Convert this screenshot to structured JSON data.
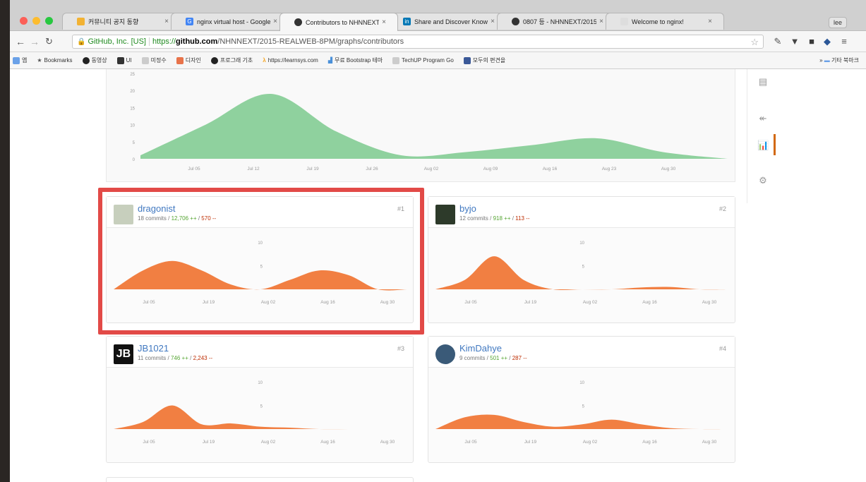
{
  "browser": {
    "tabs": [
      {
        "title": "커뮤니티 공지 동향",
        "color": "#f2b233",
        "active": false
      },
      {
        "title": "nginx virtual host - Google",
        "color": "#4285f4",
        "active": false
      },
      {
        "title": "Contributors to NHNNEXT",
        "color": "#333333",
        "active": true
      },
      {
        "title": "Share and Discover Knowl",
        "color": "#0077b5",
        "active": false
      },
      {
        "title": "0807 등 - NHNNEXT/2015",
        "color": "#333333",
        "active": false
      },
      {
        "title": "Welcome to nginx!",
        "color": "#dddddd",
        "active": false
      }
    ],
    "new_tab_label": "lee",
    "site_identity": "GitHub, Inc. [US]",
    "url_scheme": "https://",
    "url_host": "github.com",
    "url_path": "/NHNNEXT/2015-REALWEB-8PM/graphs/contributors",
    "bookmarks": [
      {
        "label": "앱",
        "color": "#6aa1e8"
      },
      {
        "label": "Bookmarks",
        "color": "#777777"
      },
      {
        "label": "동영상",
        "color": "#222222"
      },
      {
        "label": "UI",
        "color": "#333333"
      },
      {
        "label": "미정수",
        "color": "#cccccc"
      },
      {
        "label": "디자인",
        "color": "#e8734a"
      },
      {
        "label": "프로그래 기초",
        "color": "#222222"
      },
      {
        "label": "https://learnsys.com",
        "color": "#f6a623"
      },
      {
        "label": "무료 Bootstrap 테마",
        "color": "#4a90d9"
      },
      {
        "label": "TechUP Program Go",
        "color": "#cccccc"
      },
      {
        "label": "모두의 편견을",
        "color": "#3b5998"
      }
    ],
    "other_bookmarks": "기타 북마크"
  },
  "chart_data": [
    {
      "type": "area",
      "title": "",
      "x_labels": [
        "Jul 05",
        "Jul 12",
        "Jul 19",
        "Jul 26",
        "Aug 02",
        "Aug 09",
        "Aug 16",
        "Aug 23",
        "Aug 30"
      ],
      "y_ticks": [
        0,
        5,
        10,
        15,
        20,
        25
      ],
      "ylim": [
        0,
        25
      ],
      "series": [
        {
          "values": [
            1,
            10,
            19,
            8,
            1,
            2,
            4,
            6,
            2,
            0
          ]
        }
      ],
      "color": "#8fd19e"
    },
    {
      "type": "area",
      "x_labels": [
        "Jul 05",
        "Jul 19",
        "Aug 02",
        "Aug 16",
        "Aug 30"
      ],
      "y_ticks": [
        5,
        10
      ],
      "ylim": [
        0,
        10
      ],
      "series": [
        {
          "values": [
            0,
            4,
            6,
            4,
            1,
            0,
            2,
            4,
            3,
            0,
            0
          ]
        }
      ],
      "color": "#f17f42"
    },
    {
      "type": "area",
      "x_labels": [
        "Jul 05",
        "Jul 19",
        "Aug 02",
        "Aug 16",
        "Aug 30"
      ],
      "y_ticks": [
        5,
        10
      ],
      "ylim": [
        0,
        10
      ],
      "series": [
        {
          "values": [
            0,
            2,
            7,
            2,
            0,
            0,
            0,
            0.4,
            0.5,
            0,
            0
          ]
        }
      ],
      "color": "#f17f42"
    },
    {
      "type": "area",
      "x_labels": [
        "Jul 05",
        "Jul 19",
        "Aug 02",
        "Aug 16",
        "Aug 30"
      ],
      "y_ticks": [
        5,
        10
      ],
      "ylim": [
        0,
        10
      ],
      "series": [
        {
          "values": [
            0,
            1.5,
            5,
            1,
            1.2,
            0.5,
            0.3,
            0,
            0,
            0,
            0
          ]
        }
      ],
      "color": "#f17f42"
    },
    {
      "type": "area",
      "x_labels": [
        "Jul 05",
        "Jul 19",
        "Aug 02",
        "Aug 16",
        "Aug 30"
      ],
      "y_ticks": [
        5,
        10
      ],
      "ylim": [
        0,
        10
      ],
      "series": [
        {
          "values": [
            0,
            2.5,
            3,
            1.5,
            0.5,
            1,
            2,
            1,
            0.2,
            0,
            0
          ]
        }
      ],
      "color": "#f17f42"
    }
  ],
  "contributors": [
    {
      "name": "dragonist",
      "rank": "#1",
      "commits": "18 commits",
      "additions": "12,706 ++",
      "deletions": "570 --",
      "avatar_color": "#c7cfbd"
    },
    {
      "name": "byjo",
      "rank": "#2",
      "commits": "12 commits",
      "additions": "918 ++",
      "deletions": "113 --",
      "avatar_color": "#2d3a2a"
    },
    {
      "name": "JB1021",
      "rank": "#3",
      "commits": "11 commits",
      "additions": "746 ++",
      "deletions": "2,243 --",
      "avatar_color": "#111111",
      "avatar_text": "JB"
    },
    {
      "name": "KimDahye",
      "rank": "#4",
      "commits": "9 commits",
      "additions": "501 ++",
      "deletions": "287 --",
      "avatar_color": "#3a5a78"
    }
  ],
  "rail": {
    "icons": [
      "book-icon",
      "pull-request-icon",
      "graph-icon",
      "gear-icon"
    ],
    "accent": "#d26911"
  },
  "highlight_color": "#e24a47"
}
